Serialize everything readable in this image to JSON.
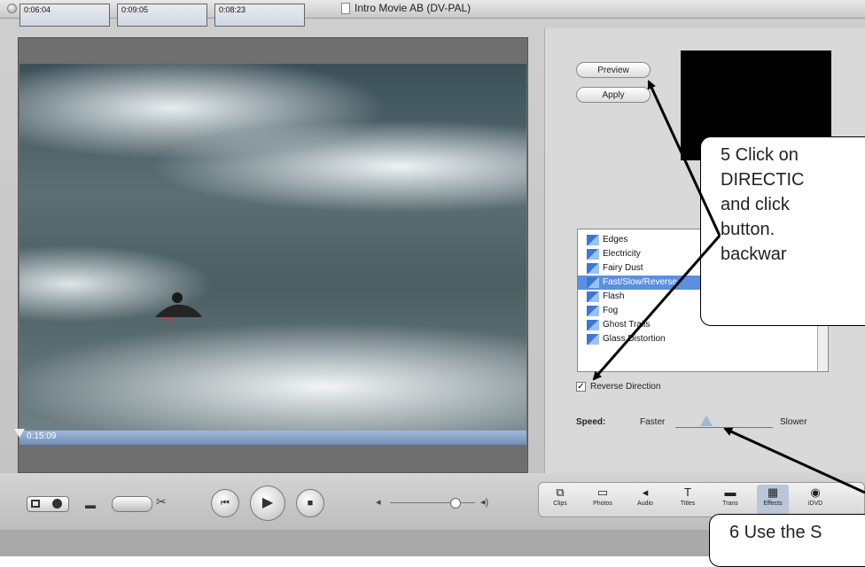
{
  "window": {
    "title": "Intro Movie AB (DV-PAL)"
  },
  "viewer": {
    "timecode": "0:15:09"
  },
  "effects_panel": {
    "preview_label": "Preview",
    "apply_label": "Apply",
    "effects_list": [
      "Edges",
      "Electricity",
      "Fairy Dust",
      "Fast/Slow/Reverse",
      "Flash",
      "Fog",
      "Ghost Trails",
      "Glass Distortion"
    ],
    "selected_effect": "Fast/Slow/Reverse",
    "reverse_direction_label": "Reverse Direction",
    "reverse_direction_checked": true,
    "speed_label": "Speed:",
    "speed_min_label": "Faster",
    "speed_max_label": "Slower",
    "speed_level": 0.3
  },
  "tabs": [
    {
      "label": "Clips",
      "icon": "clips-icon"
    },
    {
      "label": "Photos",
      "icon": "photos-icon"
    },
    {
      "label": "Audio",
      "icon": "audio-icon"
    },
    {
      "label": "Titles",
      "icon": "titles-icon"
    },
    {
      "label": "Trans",
      "icon": "transitions-icon"
    },
    {
      "label": "Effects",
      "icon": "effects-icon",
      "active": true
    },
    {
      "label": "iDVD",
      "icon": "idvd-icon"
    }
  ],
  "clips": [
    "0:06:04",
    "0:09:05",
    "0:08:23"
  ],
  "callouts": {
    "step5": "5 Click on \nDIRECTIC\nand click\nbutton.\nbackwar",
    "step6": "6 Use the S"
  },
  "colors": {
    "selection": "#5b8fe0",
    "scrubber": "#7f9cc4"
  }
}
